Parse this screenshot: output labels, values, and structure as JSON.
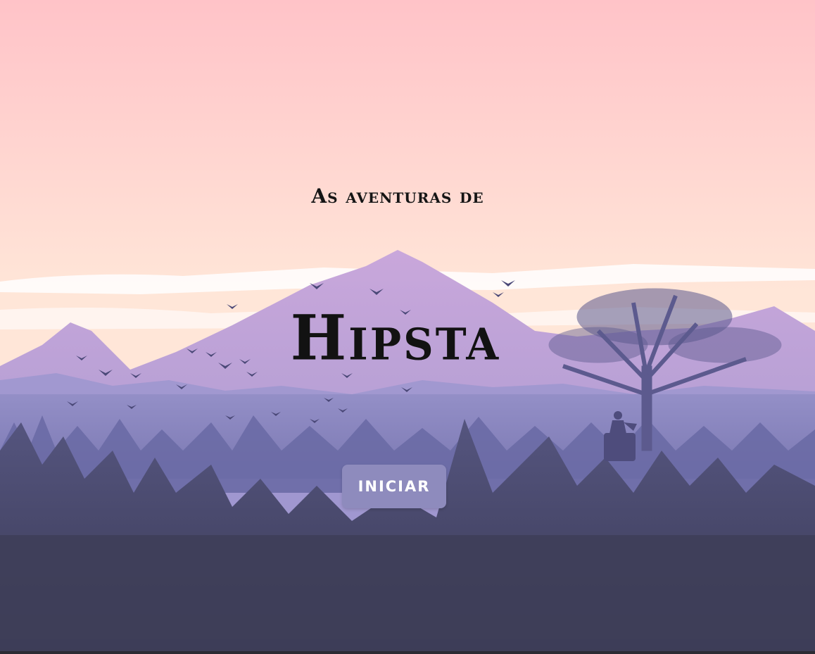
{
  "screen": {
    "subtitle": "As aventuras de",
    "title": "Hipsta",
    "start_button_label": "INICIAR"
  },
  "colors": {
    "sky_top": "#ffc3c8",
    "sky_bottom": "#ffe3d6",
    "mountain_far": "#a49cd0",
    "mountain_peak": "#c7a3d6",
    "forest_mid": "#6e6ea8",
    "forest_dark": "#3d3d5a",
    "button_bg": "#8e8bbd",
    "button_text": "#ffffff",
    "title_text": "#121212"
  },
  "icons": [
    "birds-flock",
    "tree-silhouette",
    "hiker-on-rock"
  ]
}
